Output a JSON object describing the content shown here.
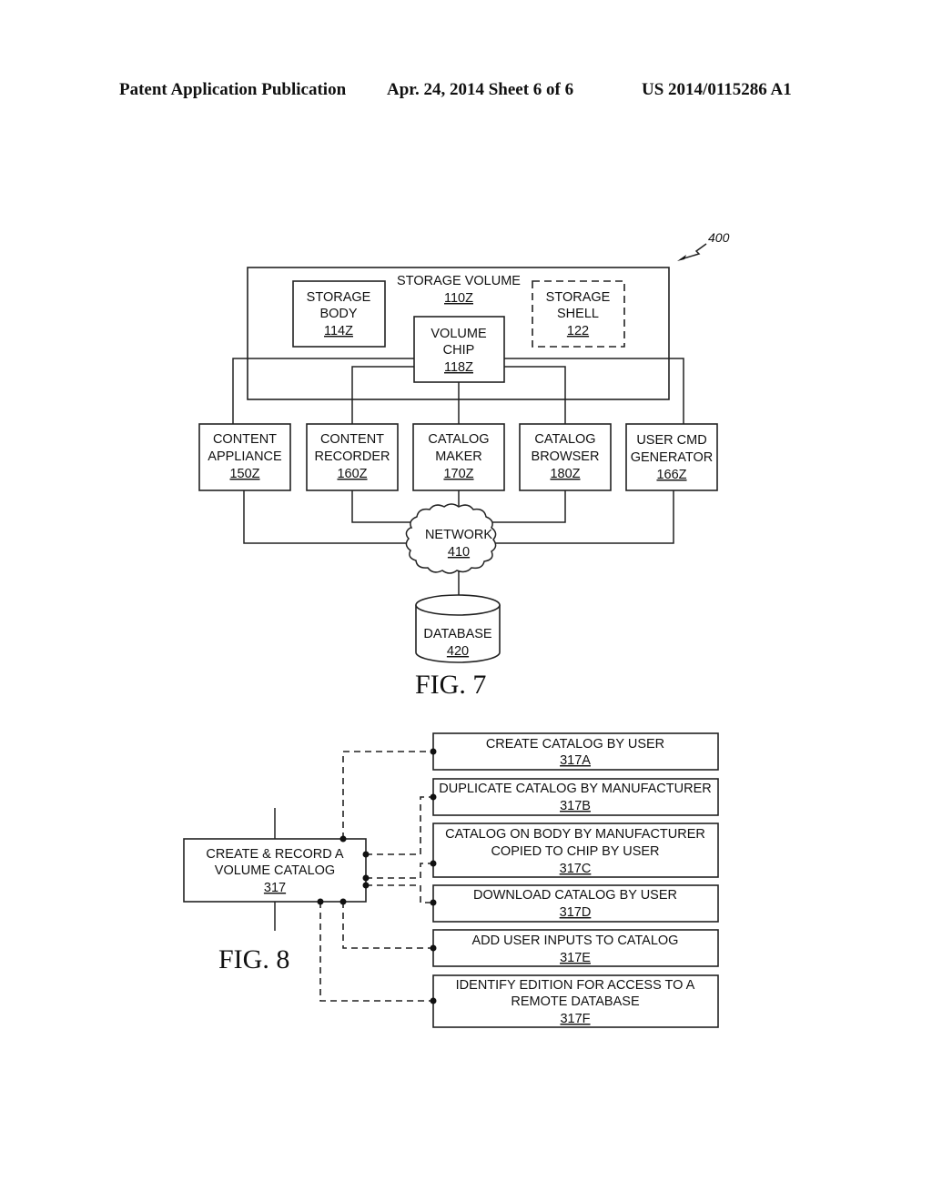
{
  "header": {
    "publication": "Patent Application Publication",
    "date_sheet": "Apr. 24, 2014  Sheet 6 of 6",
    "patent_number": "US 2014/0115286 A1"
  },
  "fig7": {
    "ref_number": "400",
    "caption": "FIG. 7",
    "storage_volume": {
      "title": "STORAGE VOLUME",
      "ref": "110Z"
    },
    "storage_body": {
      "lines": [
        "STORAGE",
        "BODY"
      ],
      "ref": "114Z"
    },
    "storage_shell": {
      "lines": [
        "STORAGE",
        "SHELL"
      ],
      "ref": "122"
    },
    "volume_chip": {
      "lines": [
        "VOLUME",
        "CHIP"
      ],
      "ref": "118Z"
    },
    "devices": [
      {
        "lines": [
          "CONTENT",
          "APPLIANCE"
        ],
        "ref": "150Z"
      },
      {
        "lines": [
          "CONTENT",
          "RECORDER"
        ],
        "ref": "160Z"
      },
      {
        "lines": [
          "CATALOG",
          "MAKER"
        ],
        "ref": "170Z"
      },
      {
        "lines": [
          "CATALOG",
          "BROWSER"
        ],
        "ref": "180Z"
      },
      {
        "lines": [
          "USER CMD",
          "GENERATOR"
        ],
        "ref": "166Z"
      }
    ],
    "network": {
      "title": "NETWORK",
      "ref": "410"
    },
    "database": {
      "title": "DATABASE",
      "ref": "420"
    }
  },
  "fig8": {
    "caption": "FIG. 8",
    "main": {
      "lines": [
        "CREATE & RECORD A",
        "VOLUME CATALOG"
      ],
      "ref": "317"
    },
    "options": [
      {
        "lines": [
          "CREATE CATALOG BY USER"
        ],
        "ref": "317A"
      },
      {
        "lines": [
          "DUPLICATE CATALOG BY MANUFACTURER"
        ],
        "ref": "317B"
      },
      {
        "lines": [
          "CATALOG ON BODY BY MANUFACTURER",
          "COPIED TO CHIP BY USER"
        ],
        "ref": "317C"
      },
      {
        "lines": [
          "DOWNLOAD CATALOG BY USER"
        ],
        "ref": "317D"
      },
      {
        "lines": [
          "ADD USER INPUTS TO CATALOG"
        ],
        "ref": "317E"
      },
      {
        "lines": [
          "IDENTIFY EDITION FOR ACCESS TO A",
          "REMOTE DATABASE"
        ],
        "ref": "317F"
      }
    ]
  }
}
